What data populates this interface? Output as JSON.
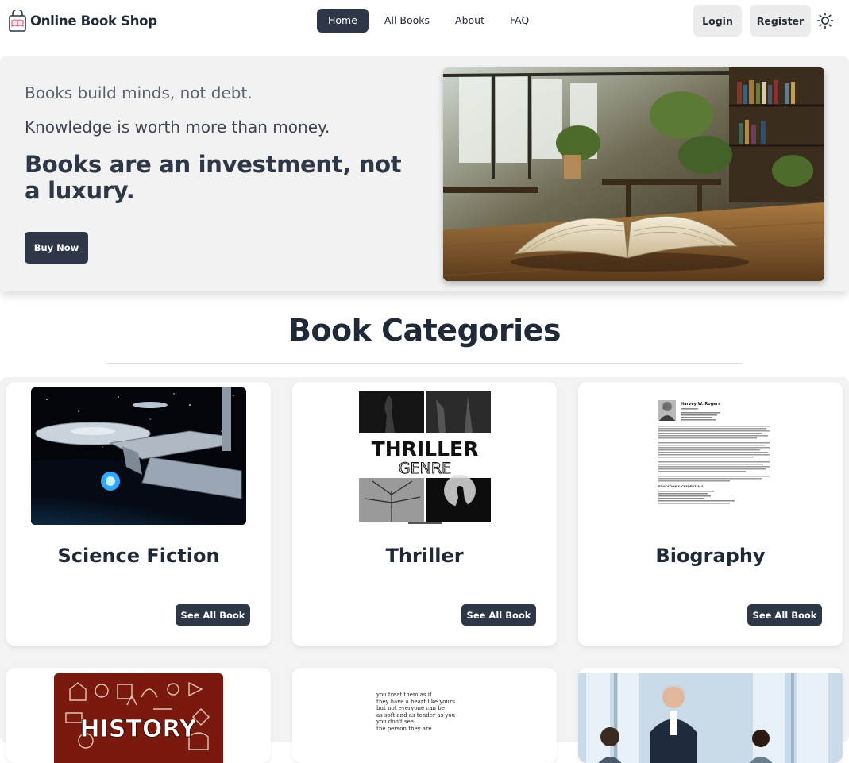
{
  "navbar": {
    "brand": "Online Book Shop",
    "links": [
      "Home",
      "All Books",
      "About",
      "FAQ"
    ],
    "active_link": "Home",
    "login": "Login",
    "register": "Register"
  },
  "hero": {
    "line1": "Books build minds, not debt.",
    "line2": "Knowledge is worth more than money.",
    "headline": "Books are an investment, not a luxury.",
    "cta": "Buy Now"
  },
  "categories": {
    "title": "Book Categories",
    "items": [
      {
        "title": "Science Fiction",
        "button": "See All Book"
      },
      {
        "title": "Thriller",
        "button": "See All Book"
      },
      {
        "title": "Biography",
        "button": "See All Book"
      },
      {
        "title": "",
        "button": ""
      },
      {
        "title": "",
        "button": ""
      },
      {
        "title": "",
        "button": ""
      }
    ],
    "thriller_art": {
      "word1": "THRILLER",
      "word2": "GENRE"
    },
    "history_art": {
      "word": "HISTORY"
    },
    "biography_doc": {
      "name": "Harvey W. Rogers",
      "section": "EDUCATION & CREDENTIALS"
    },
    "poem_lines": [
      "you treat them as if",
      "they have a heart like yours",
      "but not everyone can be",
      "as soft and as tender as you",
      "you don't see",
      "the person they are"
    ]
  },
  "colors": {
    "primary": "#2d3748",
    "hero_bg": "#f2f2f2",
    "auth_bg": "#ececec",
    "history_cover": "#7a1a0e"
  },
  "icons": {
    "brand": "shopping-bag-book-icon",
    "theme": "sun-icon"
  }
}
